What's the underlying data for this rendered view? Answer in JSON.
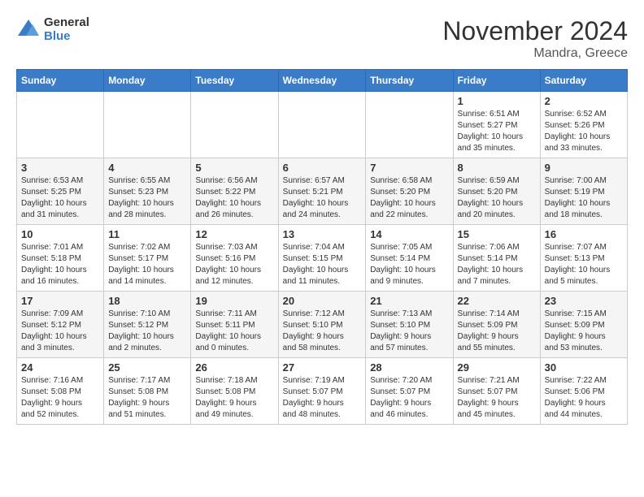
{
  "logo": {
    "general": "General",
    "blue": "Blue"
  },
  "title": "November 2024",
  "location": "Mandra, Greece",
  "days_of_week": [
    "Sunday",
    "Monday",
    "Tuesday",
    "Wednesday",
    "Thursday",
    "Friday",
    "Saturday"
  ],
  "weeks": [
    [
      {
        "day": "",
        "info": ""
      },
      {
        "day": "",
        "info": ""
      },
      {
        "day": "",
        "info": ""
      },
      {
        "day": "",
        "info": ""
      },
      {
        "day": "",
        "info": ""
      },
      {
        "day": "1",
        "info": "Sunrise: 6:51 AM\nSunset: 5:27 PM\nDaylight: 10 hours\nand 35 minutes."
      },
      {
        "day": "2",
        "info": "Sunrise: 6:52 AM\nSunset: 5:26 PM\nDaylight: 10 hours\nand 33 minutes."
      }
    ],
    [
      {
        "day": "3",
        "info": "Sunrise: 6:53 AM\nSunset: 5:25 PM\nDaylight: 10 hours\nand 31 minutes."
      },
      {
        "day": "4",
        "info": "Sunrise: 6:55 AM\nSunset: 5:23 PM\nDaylight: 10 hours\nand 28 minutes."
      },
      {
        "day": "5",
        "info": "Sunrise: 6:56 AM\nSunset: 5:22 PM\nDaylight: 10 hours\nand 26 minutes."
      },
      {
        "day": "6",
        "info": "Sunrise: 6:57 AM\nSunset: 5:21 PM\nDaylight: 10 hours\nand 24 minutes."
      },
      {
        "day": "7",
        "info": "Sunrise: 6:58 AM\nSunset: 5:20 PM\nDaylight: 10 hours\nand 22 minutes."
      },
      {
        "day": "8",
        "info": "Sunrise: 6:59 AM\nSunset: 5:20 PM\nDaylight: 10 hours\nand 20 minutes."
      },
      {
        "day": "9",
        "info": "Sunrise: 7:00 AM\nSunset: 5:19 PM\nDaylight: 10 hours\nand 18 minutes."
      }
    ],
    [
      {
        "day": "10",
        "info": "Sunrise: 7:01 AM\nSunset: 5:18 PM\nDaylight: 10 hours\nand 16 minutes."
      },
      {
        "day": "11",
        "info": "Sunrise: 7:02 AM\nSunset: 5:17 PM\nDaylight: 10 hours\nand 14 minutes."
      },
      {
        "day": "12",
        "info": "Sunrise: 7:03 AM\nSunset: 5:16 PM\nDaylight: 10 hours\nand 12 minutes."
      },
      {
        "day": "13",
        "info": "Sunrise: 7:04 AM\nSunset: 5:15 PM\nDaylight: 10 hours\nand 11 minutes."
      },
      {
        "day": "14",
        "info": "Sunrise: 7:05 AM\nSunset: 5:14 PM\nDaylight: 10 hours\nand 9 minutes."
      },
      {
        "day": "15",
        "info": "Sunrise: 7:06 AM\nSunset: 5:14 PM\nDaylight: 10 hours\nand 7 minutes."
      },
      {
        "day": "16",
        "info": "Sunrise: 7:07 AM\nSunset: 5:13 PM\nDaylight: 10 hours\nand 5 minutes."
      }
    ],
    [
      {
        "day": "17",
        "info": "Sunrise: 7:09 AM\nSunset: 5:12 PM\nDaylight: 10 hours\nand 3 minutes."
      },
      {
        "day": "18",
        "info": "Sunrise: 7:10 AM\nSunset: 5:12 PM\nDaylight: 10 hours\nand 2 minutes."
      },
      {
        "day": "19",
        "info": "Sunrise: 7:11 AM\nSunset: 5:11 PM\nDaylight: 10 hours\nand 0 minutes."
      },
      {
        "day": "20",
        "info": "Sunrise: 7:12 AM\nSunset: 5:10 PM\nDaylight: 9 hours\nand 58 minutes."
      },
      {
        "day": "21",
        "info": "Sunrise: 7:13 AM\nSunset: 5:10 PM\nDaylight: 9 hours\nand 57 minutes."
      },
      {
        "day": "22",
        "info": "Sunrise: 7:14 AM\nSunset: 5:09 PM\nDaylight: 9 hours\nand 55 minutes."
      },
      {
        "day": "23",
        "info": "Sunrise: 7:15 AM\nSunset: 5:09 PM\nDaylight: 9 hours\nand 53 minutes."
      }
    ],
    [
      {
        "day": "24",
        "info": "Sunrise: 7:16 AM\nSunset: 5:08 PM\nDaylight: 9 hours\nand 52 minutes."
      },
      {
        "day": "25",
        "info": "Sunrise: 7:17 AM\nSunset: 5:08 PM\nDaylight: 9 hours\nand 51 minutes."
      },
      {
        "day": "26",
        "info": "Sunrise: 7:18 AM\nSunset: 5:08 PM\nDaylight: 9 hours\nand 49 minutes."
      },
      {
        "day": "27",
        "info": "Sunrise: 7:19 AM\nSunset: 5:07 PM\nDaylight: 9 hours\nand 48 minutes."
      },
      {
        "day": "28",
        "info": "Sunrise: 7:20 AM\nSunset: 5:07 PM\nDaylight: 9 hours\nand 46 minutes."
      },
      {
        "day": "29",
        "info": "Sunrise: 7:21 AM\nSunset: 5:07 PM\nDaylight: 9 hours\nand 45 minutes."
      },
      {
        "day": "30",
        "info": "Sunrise: 7:22 AM\nSunset: 5:06 PM\nDaylight: 9 hours\nand 44 minutes."
      }
    ]
  ]
}
